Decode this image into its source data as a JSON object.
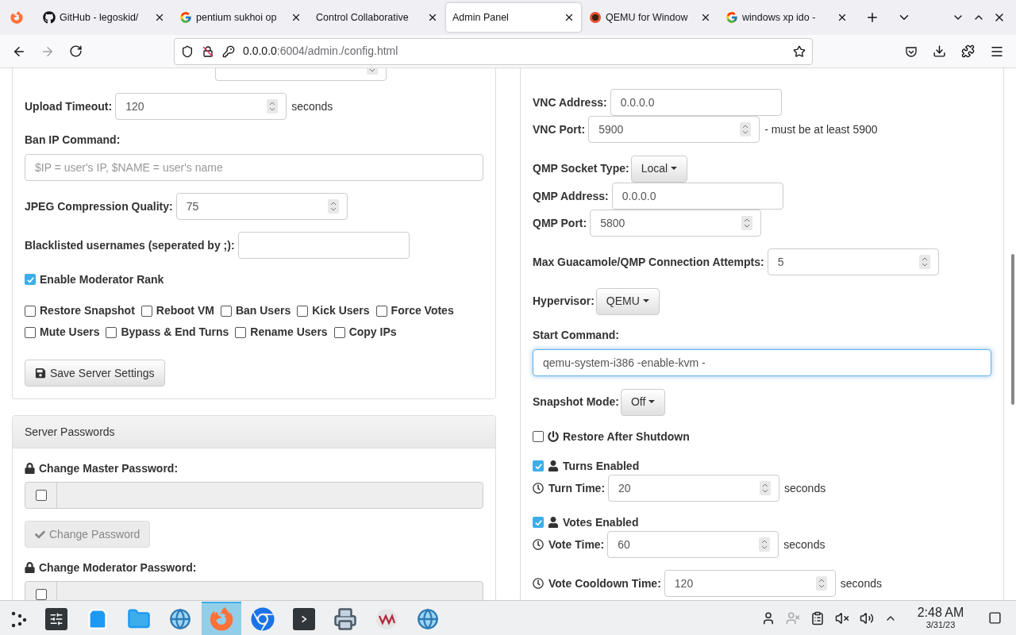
{
  "browser": {
    "tabs": [
      {
        "title": "GitHub - legoskid/",
        "kind": "github",
        "selected": false
      },
      {
        "title": "pentium sukhoi op",
        "kind": "google",
        "selected": false
      },
      {
        "title": "Control Collaborative",
        "kind": "plain",
        "selected": false
      },
      {
        "title": "Admin Panel",
        "kind": "plain",
        "selected": true
      },
      {
        "title": "QEMU for Window",
        "kind": "qemu",
        "selected": false
      },
      {
        "title": "windows xp ido - ",
        "kind": "google",
        "selected": false
      }
    ],
    "url": {
      "host": "0.0.0.0",
      "path": ":6004/admin./config.html"
    }
  },
  "server_settings": {
    "groups": [
      [
        {
          "kind": "number"
        }
      ],
      [
        {
          "kind": "number",
          "label": "Upload Timeout:",
          "value": "120",
          "suffix": "seconds"
        }
      ],
      [
        {
          "kind": "label",
          "label": "Ban IP Command:"
        },
        {
          "kind": "wide_text",
          "placeholder": "$IP = user's IP, $NAME = user's name",
          "focused": false
        }
      ],
      [
        {
          "kind": "number",
          "label": "JPEG Compression Quality:",
          "value": "75"
        }
      ],
      [
        {
          "kind": "text",
          "label": "Blacklisted usernames (seperated by ;):"
        }
      ],
      [
        {
          "kind": "check",
          "label": "Enable Moderator Rank",
          "checked": true
        }
      ],
      [
        {
          "kind": "checks",
          "items": [
            {
              "label": "Restore Snapshot",
              "checked": false
            },
            {
              "label": "Reboot VM",
              "checked": false
            },
            {
              "label": "Ban Users",
              "checked": false
            },
            {
              "label": "Kick Users",
              "checked": false
            },
            {
              "label": "Force Votes",
              "checked": false
            }
          ]
        },
        {
          "kind": "checks",
          "items": [
            {
              "label": "Mute Users",
              "checked": false
            },
            {
              "label": "Bypass & End Turns",
              "checked": false
            },
            {
              "label": "Rename Users",
              "checked": false
            },
            {
              "label": "Copy IPs",
              "checked": false
            }
          ]
        }
      ],
      [
        {
          "kind": "save_button",
          "label": "Save Server Settings"
        }
      ]
    ]
  },
  "server_passwords": {
    "heading": "Server Passwords",
    "groups": [
      [
        {
          "kind": "lock_label",
          "label": "Change Master Password:"
        },
        {
          "kind": "password",
          "checked": false,
          "disabled": true
        }
      ],
      [
        {
          "kind": "check_button",
          "label": "Change Password",
          "disabled": true
        }
      ],
      [
        {
          "kind": "lock_label",
          "label": "Change Moderator Password:"
        },
        {
          "kind": "password",
          "checked": false,
          "disabled": true
        }
      ]
    ]
  },
  "vm_settings": {
    "groups": [
      [
        {
          "kind": "text",
          "label": "VNC Address:",
          "value": "0.0.0.0"
        },
        {
          "kind": "number",
          "label": "VNC Port:",
          "value": "5900",
          "suffix": "- must be at least 5900"
        }
      ],
      [
        {
          "kind": "dropdown",
          "label": "QMP Socket Type:",
          "value": "Local"
        },
        {
          "kind": "text",
          "label": "QMP Address:",
          "value": "0.0.0.0"
        },
        {
          "kind": "number",
          "label": "QMP Port:",
          "value": "5800"
        }
      ],
      [
        {
          "kind": "number",
          "label": "Max Guacamole/QMP Connection Attempts:",
          "value": "5"
        }
      ],
      [
        {
          "kind": "dropdown",
          "label": "Hypervisor:",
          "value": "QEMU"
        }
      ],
      [
        {
          "kind": "label",
          "label": "Start Command:"
        },
        {
          "kind": "wide_text",
          "value": "qemu-system-i386 -enable-kvm -",
          "focused": true
        }
      ],
      [
        {
          "kind": "dropdown",
          "label": "Snapshot Mode:",
          "value": "Off"
        }
      ],
      [
        {
          "kind": "power_check",
          "label": "Restore After Shutdown",
          "checked": false
        }
      ],
      [
        {
          "kind": "user_check",
          "label": "Turns Enabled",
          "checked": true
        },
        {
          "kind": "clock_number",
          "label": "Turn Time:",
          "value": "20",
          "suffix": "seconds"
        }
      ],
      [
        {
          "kind": "user_check",
          "label": "Votes Enabled",
          "checked": true
        },
        {
          "kind": "clock_number",
          "label": "Vote Time:",
          "value": "60",
          "suffix": "seconds"
        }
      ],
      [
        {
          "kind": "clock_number",
          "label": "Vote Cooldown Time:",
          "value": "120",
          "suffix": "seconds"
        }
      ]
    ]
  },
  "taskbar": {
    "apps": [
      {
        "kind": "launcher",
        "selected": false
      },
      {
        "kind": "settings",
        "selected": false
      },
      {
        "kind": "store",
        "selected": false
      },
      {
        "kind": "files",
        "selected": false
      },
      {
        "kind": "globe",
        "selected": false
      },
      {
        "kind": "firefox",
        "selected": true
      },
      {
        "kind": "chrome",
        "selected": false
      },
      {
        "kind": "terminal",
        "selected": false
      },
      {
        "kind": "scanner",
        "selected": false
      },
      {
        "kind": "vm",
        "selected": false
      },
      {
        "kind": "globe",
        "selected": false
      }
    ],
    "clock": {
      "time": "2:48 AM",
      "date": "3/31/23"
    }
  }
}
